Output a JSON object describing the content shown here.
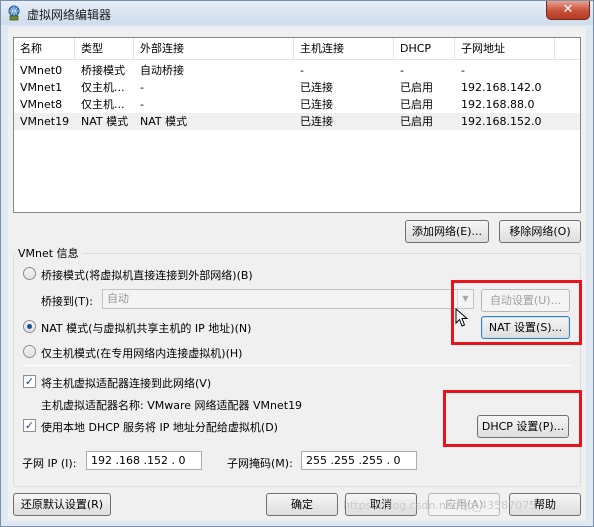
{
  "window": {
    "title": "虚拟网络编辑器",
    "close_label": "✕"
  },
  "network_list": {
    "columns": [
      "名称",
      "类型",
      "外部连接",
      "主机连接",
      "DHCP",
      "子网地址"
    ],
    "rows": [
      [
        "VMnet0",
        "桥接模式",
        "自动桥接",
        "-",
        "-",
        "-"
      ],
      [
        "VMnet1",
        "仅主机...",
        "-",
        "已连接",
        "已启用",
        "192.168.142.0"
      ],
      [
        "VMnet8",
        "仅主机...",
        "-",
        "已连接",
        "已启用",
        "192.168.88.0"
      ],
      [
        "VMnet19",
        "NAT 模式",
        "NAT 模式",
        "已连接",
        "已启用",
        "192.168.152.0"
      ]
    ],
    "selected_row": 3
  },
  "list_buttons": {
    "add": "添加网络(E)...",
    "remove": "移除网络(O)"
  },
  "vmnet_info": {
    "legend": "VMnet 信息",
    "bridged_radio": "桥接模式(将虚拟机直接连接到外部网络)(B)",
    "bridged_to_label": "桥接到(T):",
    "bridged_to_value": "自动",
    "auto_settings_button": "自动设置(U)...",
    "nat_radio": "NAT 模式(与虚拟机共享主机的 IP 地址)(N)",
    "nat_settings_button": "NAT 设置(S)...",
    "host_only_radio": "仅主机模式(在专用网络内连接虚拟机)(H)",
    "selected_mode": "nat",
    "connect_adapter_check": "将主机虚拟适配器连接到此网络(V)",
    "connect_adapter_checked": true,
    "adapter_name_label": "主机虚拟适配器名称: VMware 网络适配器 VMnet19",
    "dhcp_check": "使用本地 DHCP 服务将 IP 地址分配给虚拟机(D)",
    "dhcp_checked": true,
    "dhcp_settings_button": "DHCP 设置(P)...",
    "subnet_ip_label": "子网 IP (I):",
    "subnet_ip_value": "192 .168 .152 . 0",
    "subnet_mask_label": "子网掩码(M):",
    "subnet_mask_value": "255 .255 .255 . 0"
  },
  "footer_buttons": {
    "restore": "还原默认设置(R)",
    "ok": "确定",
    "cancel": "取消",
    "apply": "应用(A)",
    "help": "帮助"
  },
  "watermark": "https://blog.csdn.net/qq_43587075",
  "colors": {
    "highlight": "#e8141b",
    "accent": "#3c7fb1"
  }
}
